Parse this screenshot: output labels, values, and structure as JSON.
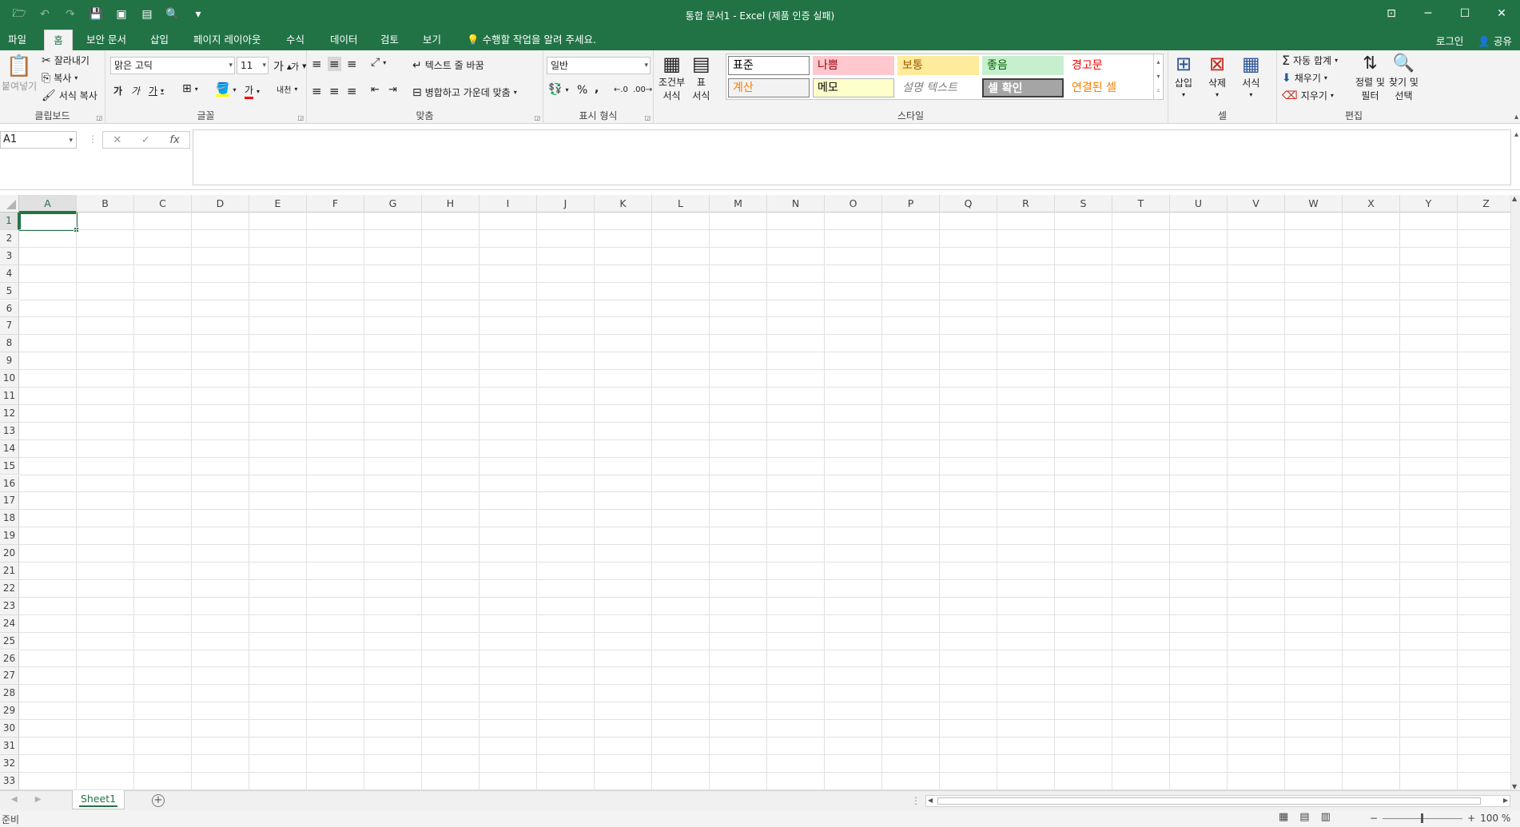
{
  "window": {
    "title": "통합 문서1 - Excel (제품 인증 실패)",
    "minimize": "─",
    "maximize": "☐",
    "close": "✕",
    "ribbon_display": "⊡"
  },
  "qat": [
    "save-icon",
    "undo-icon",
    "redo-icon",
    "save-as-icon",
    "print-preview-icon",
    "print-icon",
    "customize-icon"
  ],
  "tabs": [
    {
      "label": "파일",
      "active": false
    },
    {
      "label": "홈",
      "active": true
    },
    {
      "label": "보안 문서",
      "active": false
    },
    {
      "label": "삽입",
      "active": false
    },
    {
      "label": "페이지 레이아웃",
      "active": false
    },
    {
      "label": "수식",
      "active": false
    },
    {
      "label": "데이터",
      "active": false
    },
    {
      "label": "검토",
      "active": false
    },
    {
      "label": "보기",
      "active": false
    }
  ],
  "tell_me": "수행할 작업을 알려 주세요.",
  "signin": "로그인",
  "share": "공유",
  "ribbon": {
    "clipboard": {
      "label": "클립보드",
      "paste": "붙여넣기",
      "cut": "잘라내기",
      "copy": "복사",
      "format_painter": "서식 복사"
    },
    "font": {
      "label": "글꼴",
      "name": "맑은 고딕",
      "size": "11",
      "grow": "가",
      "shrink": "가",
      "bold": "가",
      "italic": "가",
      "underline": "가",
      "font_color": "가",
      "phonetic": "내천"
    },
    "alignment": {
      "label": "맞춤",
      "wrap": "텍스트 줄 바꿈",
      "merge": "병합하고 가운데 맞춤"
    },
    "number": {
      "label": "표시 형식",
      "format": "일반",
      "percent": "%",
      "comma": ","
    },
    "styles": {
      "label": "스타일",
      "conditional": "조건부\n서식",
      "table": "표\n서식",
      "cells": [
        {
          "name": "표준",
          "bg": "#ffffff",
          "fg": "#000000",
          "border": "#7a7a7a"
        },
        {
          "name": "나쁨",
          "bg": "#ffc7ce",
          "fg": "#9c0006",
          "border": "#ffc7ce"
        },
        {
          "name": "보통",
          "bg": "#ffeb9c",
          "fg": "#9c5700",
          "border": "#ffeb9c"
        },
        {
          "name": "좋음",
          "bg": "#c6efce",
          "fg": "#006100",
          "border": "#c6efce"
        },
        {
          "name": "경고문",
          "bg": "#ffffff",
          "fg": "#ff0000",
          "border": "#ffffff"
        },
        {
          "name": "계산",
          "bg": "#f2f2f2",
          "fg": "#fa7d00",
          "border": "#7f7f7f"
        },
        {
          "name": "메모",
          "bg": "#ffffcc",
          "fg": "#000000",
          "border": "#b2b2b2"
        },
        {
          "name": "설명 텍스트",
          "bg": "#ffffff",
          "fg": "#7f7f7f",
          "border": "#ffffff"
        },
        {
          "name": "셀 확인",
          "bg": "#a5a5a5",
          "fg": "#ffffff",
          "border": "#3f3f3f"
        },
        {
          "name": "연결된 셀",
          "bg": "#ffffff",
          "fg": "#fa7d00",
          "border": "#ffffff"
        }
      ]
    },
    "cells": {
      "label": "셀",
      "insert": "삽입",
      "delete": "삭제",
      "format": "서식"
    },
    "editing": {
      "label": "편집",
      "autosum": "자동 합계",
      "fill": "채우기",
      "clear": "지우기",
      "sort": "정렬 및\n필터",
      "find": "찾기 및\n선택"
    }
  },
  "formula_bar": {
    "name_box": "A1",
    "fx": "fx",
    "value": ""
  },
  "columns": [
    "A",
    "B",
    "C",
    "D",
    "E",
    "F",
    "G",
    "H",
    "I",
    "J",
    "K",
    "L",
    "M",
    "N",
    "O",
    "P",
    "Q",
    "R",
    "S",
    "T",
    "U",
    "V",
    "W",
    "X",
    "Y",
    "Z"
  ],
  "rows": [
    "1",
    "2",
    "3",
    "4",
    "5",
    "6",
    "7",
    "8",
    "9",
    "10",
    "11",
    "12",
    "13",
    "14",
    "15",
    "16",
    "17",
    "18",
    "19",
    "20",
    "21",
    "22",
    "23",
    "24",
    "25",
    "26",
    "27",
    "28",
    "29",
    "30",
    "31",
    "32",
    "33"
  ],
  "active_cell": "A1",
  "sheets": [
    {
      "name": "Sheet1",
      "active": true
    }
  ],
  "status": {
    "ready": "준비",
    "zoom": "100 %"
  },
  "colors": {
    "brand": "#217346",
    "ribbon_bg": "#f3f3f3"
  }
}
